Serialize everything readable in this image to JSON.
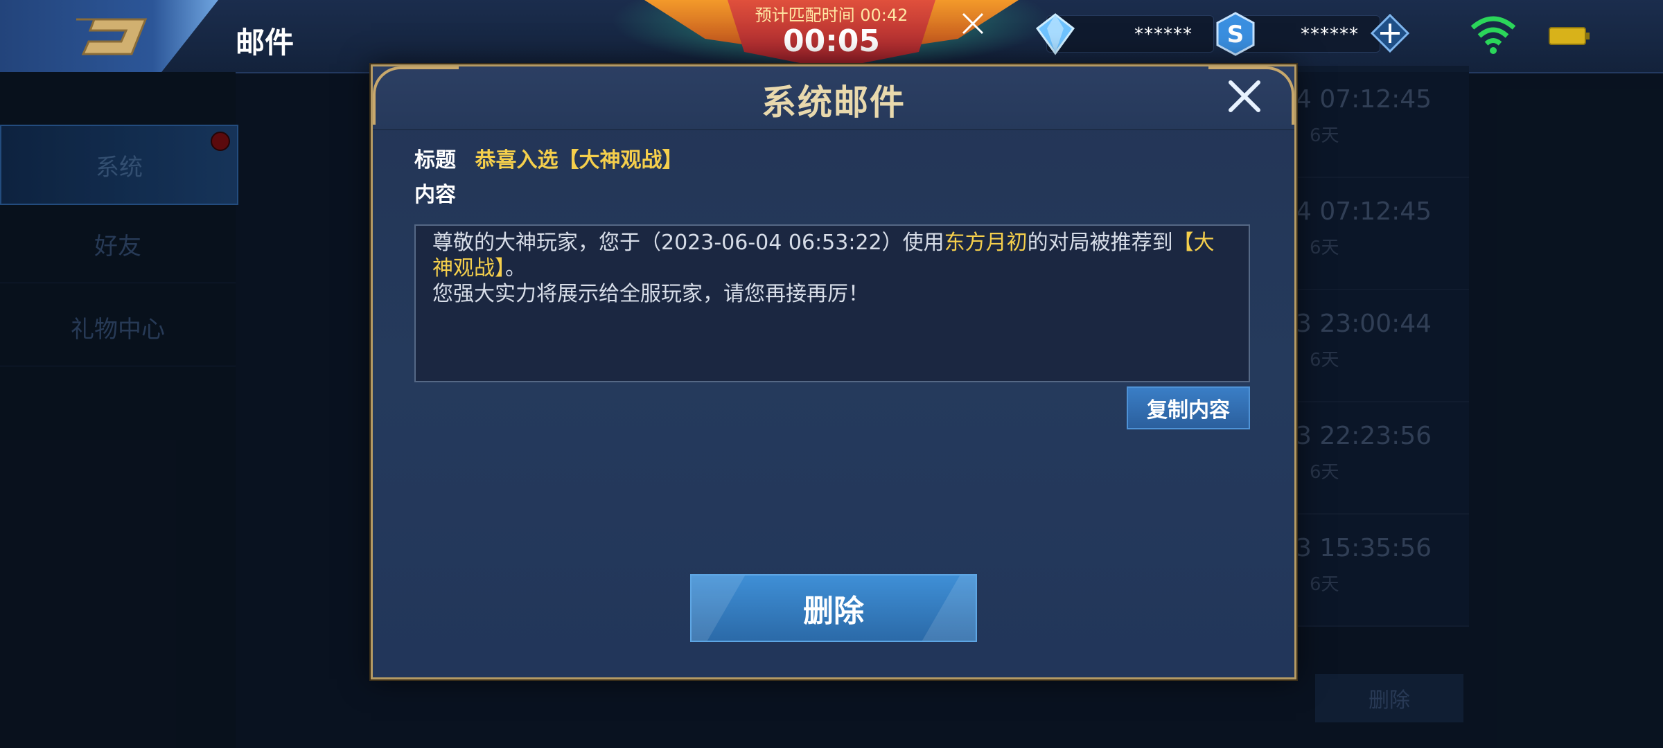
{
  "header": {
    "title": "邮件"
  },
  "matching": {
    "estimated_label": "预计匹配时间 00:42",
    "elapsed": "00:05"
  },
  "currency": {
    "gems": "******",
    "coupons": "******"
  },
  "sidebar": {
    "items": [
      {
        "label": "系统",
        "active": true
      },
      {
        "label": "好友"
      },
      {
        "label": "礼物中心"
      }
    ]
  },
  "background_list": {
    "rows": [
      {
        "time": "4 07:12:45",
        "days": "6天"
      },
      {
        "time": "4 07:12:45",
        "days": "6天"
      },
      {
        "time": "3 23:00:44",
        "days": "6天"
      },
      {
        "time": "3 22:23:56",
        "days": "6天"
      },
      {
        "time": "3 15:35:56",
        "days": "6天"
      }
    ],
    "delete_label": "删除"
  },
  "modal": {
    "title": "系统邮件",
    "subject_label": "标题",
    "subject_value": "恭喜入选【大神观战】",
    "content_label": "内容",
    "body": {
      "part1": "尊敬的大神玩家，您于（2023-06-04 06:53:22）使用",
      "hero": "东方月初",
      "part2": "的对局被推荐到",
      "highlight": "【大神观战】",
      "part3": "。",
      "line2": "您强大实力将展示给全服玩家，请您再接再厉！"
    },
    "copy_label": "复制内容",
    "delete_label": "删除"
  }
}
